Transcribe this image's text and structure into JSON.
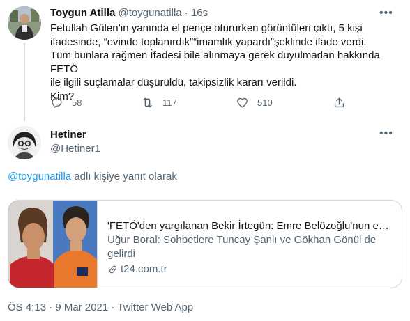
{
  "tweet": {
    "author_name": "Toygun Atilla",
    "author_handle": "@toygunatilla",
    "separator": "·",
    "time_ago": "16s",
    "lines": [
      "Fetullah Gülen’in yanında el pençe otururken görüntüleri çıktı, 5 kişi",
      "ifadesinde, “evinde toplanırdık”“imamlık yapardı”şeklinde ifade verdi.",
      "Tüm bunlara rağmen İfadesi bile alınmaya gerek duyulmadan hakkında FETÖ",
      "ile ilgili suçlamalar düşürüldü, takipsizlik kararı verildi.",
      "Kim?"
    ],
    "actions": {
      "reply_count": "58",
      "retweet_count": "117",
      "like_count": "510"
    }
  },
  "reply": {
    "author_name": "Hetiner",
    "author_handle": "@Hetiner1",
    "reply_to_mention": "@toygunatilla",
    "reply_to_suffix": " adlı kişiye yanıt olarak",
    "card": {
      "title": "'FETÖ'den yargılanan Bekir İrtegün: Emre Belözoğlu'nun evin...",
      "description": "Uğur Boral: Sohbetlere Tuncay Şanlı ve Gökhan Gönül de gelirdi",
      "domain": "t24.com.tr"
    },
    "timestamp": "ÖS 4:13 · 9 Mar 2021 · Twitter Web App"
  },
  "icons": {
    "reply": "reply-icon",
    "retweet": "retweet-icon",
    "like": "heart-icon",
    "share": "share-icon",
    "more": "more-icon",
    "link": "link-icon"
  },
  "colors": {
    "accent": "#1d9bf0",
    "secondary_text": "#536471",
    "border": "#cfd9de"
  }
}
